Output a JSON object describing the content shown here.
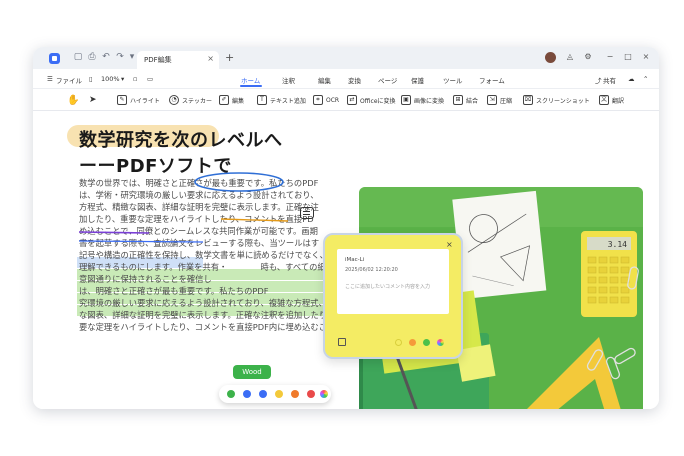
{
  "tab": {
    "title": "PDF編集"
  },
  "menubar": {
    "file": "ファイル",
    "zoom": "100%",
    "items": [
      "ホーム",
      "注釈",
      "編集",
      "変換",
      "ページ",
      "保護",
      "ツール",
      "フォーム"
    ],
    "share": "共有"
  },
  "toolbar": {
    "tools": [
      "ハイライト",
      "ステッカー",
      "編集",
      "テキスト追加",
      "OCR",
      "Officeに変換",
      "画像に変換",
      "結合",
      "圧縮",
      "スクリーンショット",
      "翻訳"
    ]
  },
  "document": {
    "heading_line1": "数学研究を次のレベルへ",
    "heading_line2": "ーーPDFソフトで",
    "lines": [
      "数学の世界では、明確さと正確さが最も重要です。私たちのPDF",
      "は、学術・研究環境の厳しい要求に応えるよう設計されており、",
      "方程式、精緻な図表、詳細な証明を完璧に表示します。正確な注",
      "加したり、重要な定理をハイライトしたり、コメントを直接PD",
      "め込むことで、同僚とのシームレスな共同作業が可能です。画期",
      "書を起草する際も、査読論文をレビューする際も、当ツールはす",
      "記号や構造の正確性を保持し、数学文書を単に読めるだけでなく、",
      "理解できるものにします。作業を共有・　　　　時も、すべての細部",
      "意図通りに保持されることを確信し　　　",
      "は、明確さと正確さが最も重要です。私たちのPDF",
      "究環境の厳しい要求に応えるよう設計されており、複雑な方程式、精密",
      "な図表、詳細な証明を完璧に表示します。正確な注釈を追加したり、重",
      "要な定理をハイライトしたり、コメントを直接PDF内に埋め込むこと"
    ]
  },
  "note": {
    "author": "iMac-Li",
    "date": "2025/06/02 12:20:20",
    "placeholder": "ここに追加したいコメント内容を入力"
  },
  "tooltip": {
    "label": "Wood"
  },
  "photo_calculator_display": "3.14",
  "colors": {
    "accent": "#3b6df5",
    "note_bg": "#f4ec64",
    "highlight_green": "#c9eab7",
    "photo_bg": "#5ab248"
  }
}
